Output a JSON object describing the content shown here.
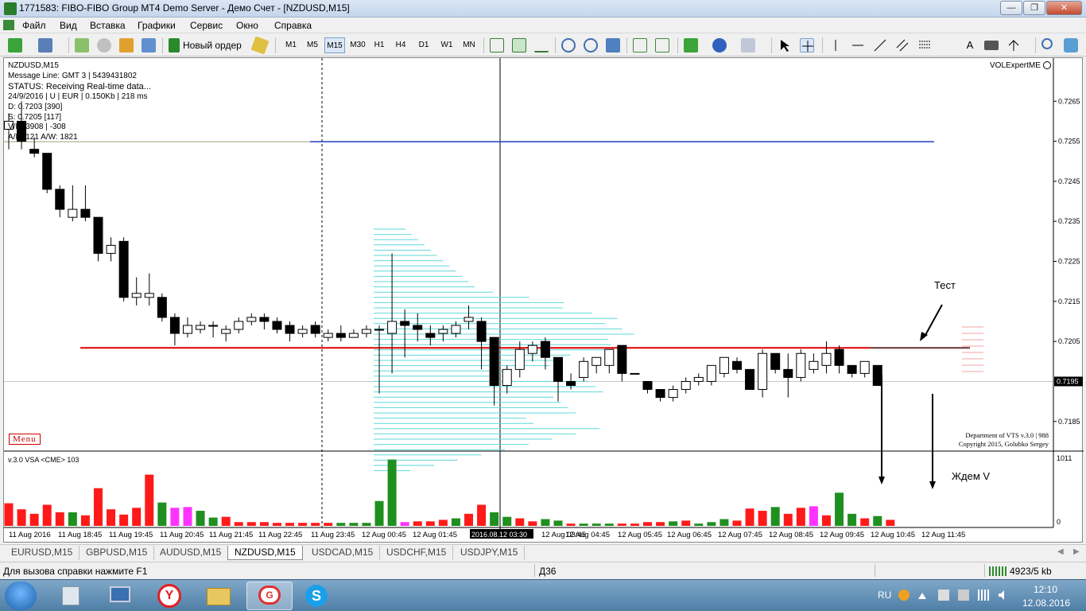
{
  "window": {
    "title": "1771583: FIBO-FIBO Group MT4 Demo Server - Демо Счет - [NZDUSD,M15]",
    "controls": {
      "minimize": "—",
      "restore": "❐",
      "close": "✕"
    }
  },
  "menu": [
    "Файл",
    "Вид",
    "Вставка",
    "Графики",
    "Сервис",
    "Окно",
    "Справка"
  ],
  "toolbar": {
    "new_order": "Новый ордер",
    "timeframes": [
      "M1",
      "M5",
      "M15",
      "M30",
      "H1",
      "H4",
      "D1",
      "W1",
      "MN"
    ],
    "active_timeframe": "M15",
    "text_tool": "A"
  },
  "chart": {
    "info_lines": [
      "NZDUSD,M15",
      "Message Line: GMT 3 | 5439431802",
      "STATUS:  Receiving Real-time data...",
      "24/9/2016 | U | EUR | 0.150Kb | 218 ms",
      "D: 0.7203  [390]",
      "S: 0.7205  [117]",
      "V/D: 3908 | -308",
      "A/D: 121  A/W: 1821"
    ],
    "expert_label": "VOLExpertME",
    "menu_button": "Menu",
    "copyright_line1": "Department of VTS  v.3.0 | 988",
    "copyright_line2": "Copyright 2015, Golubko Sergey",
    "price_ticks": [
      "0.7265",
      "0.7255",
      "0.7245",
      "0.7235",
      "0.7225",
      "0.7215",
      "0.7205",
      "0.7195",
      "0.7185"
    ],
    "current_price": "0.7195",
    "annotation_test": "Тест",
    "annotation_wait": "Ждем V",
    "indicator_label": "v.3.0 VSA <CME> 103",
    "indicator_ticks": [
      "1011",
      "0"
    ],
    "time_labels": [
      "11 Aug 2016",
      "11 Aug 18:45",
      "11 Aug 19:45",
      "11 Aug 20:45",
      "11 Aug 21:45",
      "11 Aug 22:45",
      "11 Aug 23:45",
      "12 Aug 00:45",
      "12 Aug 01:45",
      "12 Aug 03:45",
      "12 Aug 04:45",
      "12 Aug 05:45",
      "12 Aug 06:45",
      "12 Aug 07:45",
      "12 Aug 08:45",
      "12 Aug 09:45",
      "12 Aug 10:45",
      "12 Aug 11:45"
    ],
    "crosshair_time": "2016.08.12 03:30",
    "colors": {
      "support_line": "#e00000",
      "resistance_line": "#2040c0",
      "profile": "#5fd8d8",
      "vol_red": "#ff1a1a",
      "vol_green": "#1f8f1f",
      "vol_magenta": "#ff33ff"
    }
  },
  "chart_data": {
    "type": "candlestick",
    "symbol": "NZDUSD,M15",
    "ylim": [
      0.7178,
      0.7273
    ],
    "candles": [
      [
        0.7258,
        0.7262,
        0.7253,
        0.726
      ],
      [
        0.726,
        0.7265,
        0.7253,
        0.7255
      ],
      [
        0.7253,
        0.7256,
        0.7251,
        0.7252
      ],
      [
        0.7252,
        0.7252,
        0.7242,
        0.7243
      ],
      [
        0.7243,
        0.7244,
        0.7236,
        0.7238
      ],
      [
        0.7236,
        0.7244,
        0.7235,
        0.7238
      ],
      [
        0.7238,
        0.7244,
        0.7235,
        0.7236
      ],
      [
        0.7236,
        0.7236,
        0.7225,
        0.7227
      ],
      [
        0.7227,
        0.7231,
        0.7225,
        0.7229
      ],
      [
        0.723,
        0.7231,
        0.7215,
        0.7216
      ],
      [
        0.7216,
        0.7221,
        0.7214,
        0.7217
      ],
      [
        0.7216,
        0.7222,
        0.7214,
        0.7217
      ],
      [
        0.7216,
        0.7217,
        0.721,
        0.7211
      ],
      [
        0.7211,
        0.7212,
        0.7204,
        0.7207
      ],
      [
        0.7207,
        0.7211,
        0.7206,
        0.7209
      ],
      [
        0.7208,
        0.721,
        0.7207,
        0.7209
      ],
      [
        0.7209,
        0.721,
        0.7206,
        0.7209
      ],
      [
        0.7207,
        0.7209,
        0.7205,
        0.7208
      ],
      [
        0.7208,
        0.7211,
        0.7207,
        0.721
      ],
      [
        0.721,
        0.7212,
        0.7209,
        0.7211
      ],
      [
        0.7211,
        0.7212,
        0.7208,
        0.721
      ],
      [
        0.721,
        0.7211,
        0.7207,
        0.7208
      ],
      [
        0.7209,
        0.721,
        0.7205,
        0.7207
      ],
      [
        0.7207,
        0.7209,
        0.7206,
        0.7208
      ],
      [
        0.7209,
        0.721,
        0.7206,
        0.7207
      ],
      [
        0.7206,
        0.7208,
        0.7205,
        0.7207
      ],
      [
        0.7207,
        0.7209,
        0.7205,
        0.7206
      ],
      [
        0.7206,
        0.7208,
        0.7206,
        0.7207
      ],
      [
        0.7207,
        0.7209,
        0.7206,
        0.7208
      ],
      [
        0.7208,
        0.7209,
        0.7192,
        0.7208
      ],
      [
        0.7207,
        0.7227,
        0.7197,
        0.721
      ],
      [
        0.721,
        0.7213,
        0.7201,
        0.7209
      ],
      [
        0.7209,
        0.7212,
        0.7205,
        0.7208
      ],
      [
        0.7207,
        0.7209,
        0.7204,
        0.7206
      ],
      [
        0.7207,
        0.7209,
        0.7205,
        0.7208
      ],
      [
        0.7207,
        0.721,
        0.7206,
        0.7209
      ],
      [
        0.721,
        0.7214,
        0.7208,
        0.7211
      ],
      [
        0.721,
        0.7211,
        0.7198,
        0.7205
      ],
      [
        0.7206,
        0.7206,
        0.7189,
        0.7194
      ],
      [
        0.7194,
        0.7199,
        0.7192,
        0.7198
      ],
      [
        0.7198,
        0.7205,
        0.7196,
        0.7203
      ],
      [
        0.7202,
        0.7205,
        0.72,
        0.7204
      ],
      [
        0.7205,
        0.7206,
        0.7198,
        0.7201
      ],
      [
        0.7201,
        0.7201,
        0.719,
        0.7195
      ],
      [
        0.7195,
        0.7197,
        0.7193,
        0.7194
      ],
      [
        0.7196,
        0.7201,
        0.7195,
        0.72
      ],
      [
        0.7199,
        0.7201,
        0.7197,
        0.7201
      ],
      [
        0.7199,
        0.7203,
        0.7197,
        0.7203
      ],
      [
        0.7204,
        0.7204,
        0.7195,
        0.7197
      ],
      [
        0.7197,
        0.7197,
        0.7197,
        0.7197
      ],
      [
        0.7195,
        0.7195,
        0.7192,
        0.7193
      ],
      [
        0.7193,
        0.7193,
        0.719,
        0.7191
      ],
      [
        0.7191,
        0.7194,
        0.719,
        0.7193
      ],
      [
        0.7193,
        0.7196,
        0.7192,
        0.7195
      ],
      [
        0.7195,
        0.7197,
        0.7194,
        0.7196
      ],
      [
        0.7195,
        0.7199,
        0.7194,
        0.7199
      ],
      [
        0.7197,
        0.7201,
        0.7196,
        0.7201
      ],
      [
        0.72,
        0.7201,
        0.7197,
        0.7198
      ],
      [
        0.7198,
        0.7198,
        0.7193,
        0.7193
      ],
      [
        0.7193,
        0.7203,
        0.7191,
        0.7202
      ],
      [
        0.7202,
        0.7202,
        0.7197,
        0.7198
      ],
      [
        0.7198,
        0.7202,
        0.7191,
        0.7196
      ],
      [
        0.7196,
        0.7203,
        0.7195,
        0.7202
      ],
      [
        0.7198,
        0.7202,
        0.7197,
        0.72
      ],
      [
        0.7199,
        0.7205,
        0.7197,
        0.7202
      ],
      [
        0.7203,
        0.7204,
        0.7197,
        0.7199
      ],
      [
        0.7199,
        0.7199,
        0.7196,
        0.7197
      ],
      [
        0.7197,
        0.72,
        0.7196,
        0.72
      ],
      [
        0.7199,
        0.7199,
        0.7194,
        0.7194
      ]
    ],
    "volume": [
      [
        "r",
        30
      ],
      [
        "r",
        22
      ],
      [
        "r",
        16
      ],
      [
        "r",
        28
      ],
      [
        "r",
        18
      ],
      [
        "g",
        18
      ],
      [
        "r",
        14
      ],
      [
        "r",
        50
      ],
      [
        "r",
        22
      ],
      [
        "r",
        15
      ],
      [
        "r",
        24
      ],
      [
        "r",
        68
      ],
      [
        "g",
        31
      ],
      [
        "m",
        24
      ],
      [
        "m",
        25
      ],
      [
        "g",
        20
      ],
      [
        "g",
        11
      ],
      [
        "r",
        12
      ],
      [
        "r",
        5
      ],
      [
        "r",
        5
      ],
      [
        "r",
        5
      ],
      [
        "r",
        4
      ],
      [
        "r",
        4
      ],
      [
        "r",
        4
      ],
      [
        "r",
        4
      ],
      [
        "r",
        4
      ],
      [
        "g",
        4
      ],
      [
        "g",
        4
      ],
      [
        "g",
        4
      ],
      [
        "g",
        33
      ],
      [
        "g",
        88
      ],
      [
        "m",
        5
      ],
      [
        "r",
        6
      ],
      [
        "r",
        6
      ],
      [
        "r",
        8
      ],
      [
        "g",
        10
      ],
      [
        "r",
        16
      ],
      [
        "r",
        28
      ],
      [
        "g",
        18
      ],
      [
        "g",
        12
      ],
      [
        "r",
        10
      ],
      [
        "r",
        6
      ],
      [
        "g",
        9
      ],
      [
        "g",
        7
      ],
      [
        "r",
        3
      ],
      [
        "g",
        3
      ],
      [
        "g",
        3
      ],
      [
        "g",
        3
      ],
      [
        "r",
        3
      ],
      [
        "r",
        3
      ],
      [
        "r",
        5
      ],
      [
        "r",
        5
      ],
      [
        "g",
        6
      ],
      [
        "r",
        7
      ],
      [
        "g",
        3
      ],
      [
        "g",
        5
      ],
      [
        "g",
        9
      ],
      [
        "r",
        7
      ],
      [
        "r",
        23
      ],
      [
        "r",
        20
      ],
      [
        "g",
        25
      ],
      [
        "r",
        16
      ],
      [
        "r",
        24
      ],
      [
        "m",
        26
      ],
      [
        "r",
        14
      ],
      [
        "g",
        44
      ],
      [
        "g",
        16
      ],
      [
        "r",
        10
      ],
      [
        "g",
        13
      ],
      [
        "r",
        8
      ]
    ],
    "support_level": 0.72034,
    "resistance_level": 0.72549,
    "current_price": 0.7195
  },
  "tabs": [
    "EURUSD,M15",
    "GBPUSD,M15",
    "AUDUSD,M15",
    "NZDUSD,M15",
    "USDCAD,M15",
    "USDCHF,M15",
    "USDJPY,M15"
  ],
  "active_tab": "NZDUSD,M15",
  "status": {
    "help": "Для вызова справки нажмите F1",
    "profile": "Д36",
    "traffic": "4923/5 kb"
  },
  "taskbar": {
    "lang": "RU",
    "time": "12:10",
    "date": "12.08.2016"
  }
}
